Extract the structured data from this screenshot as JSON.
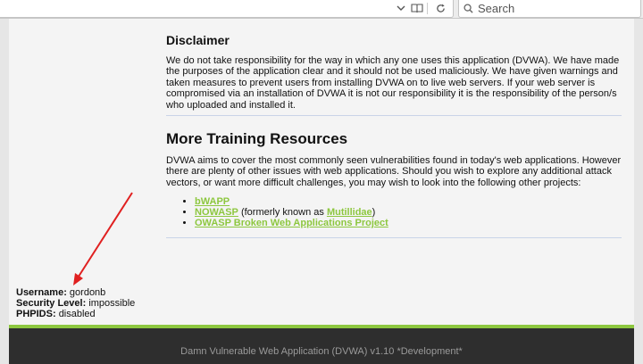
{
  "browser": {
    "search_placeholder": "Search",
    "icons": [
      "chevron-down-icon",
      "reader-view-icon",
      "bookmark-icon",
      "reload-icon",
      "search-icon"
    ]
  },
  "disclaimer": {
    "title": "Disclaimer",
    "text": "We do not take responsibility for the way in which any one uses this application (DVWA). We have made the purposes of the application clear and it should not be used maliciously. We have given warnings and taken measures to prevent users from installing DVWA on to live web servers. If your web server is compromised via an installation of DVWA it is not our responsibility it is the responsibility of the person/s who uploaded and installed it."
  },
  "resources": {
    "title": "More Training Resources",
    "text": "DVWA aims to cover the most commonly seen vulnerabilities found in today's web applications. However there are plenty of other issues with web applications. Should you wish to explore any additional attack vectors, or want more difficult challenges, you may wish to look into the following other projects:",
    "links": {
      "bwapp": "bWAPP",
      "nowasp": "NOWASP",
      "formerly": " (formerly known as ",
      "mutillidae": "Mutillidae",
      "close_paren": ")",
      "owasp": "OWASP Broken Web Applications Project"
    }
  },
  "user": {
    "username_label": "Username:",
    "username": "gordonb",
    "security_label": "Security Level:",
    "security": "impossible",
    "phpids_label": "PHPIDS:",
    "phpids": "disabled"
  },
  "footer": {
    "text": "Damn Vulnerable Web Application (DVWA) v1.10 *Development*"
  },
  "colors": {
    "link": "#8dc73f",
    "footer_bg": "#2e2e2e",
    "arrow": "#e02020"
  }
}
